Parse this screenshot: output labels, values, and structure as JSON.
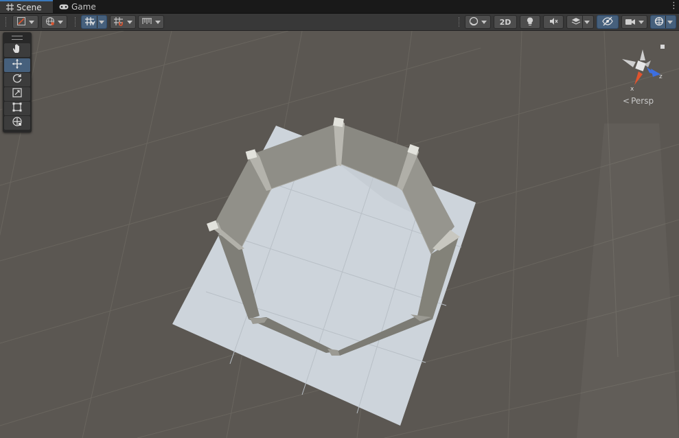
{
  "tabs": [
    {
      "label": "Scene",
      "icon": "grid-icon"
    },
    {
      "label": "Game",
      "icon": "gamepad-icon"
    }
  ],
  "toolbar": {
    "two_d_label": "2D"
  },
  "gizmo": {
    "projection_label": "Persp",
    "x_axis_label": "x",
    "z_axis_label": "z"
  },
  "colors": {
    "viewport_bg": "#5b5752",
    "floor": "#c9d0d7",
    "walls": "#8f8e87",
    "accent_blue": "#3a79bb",
    "axis_x": "#e0542e",
    "axis_z": "#3d6fe0"
  }
}
